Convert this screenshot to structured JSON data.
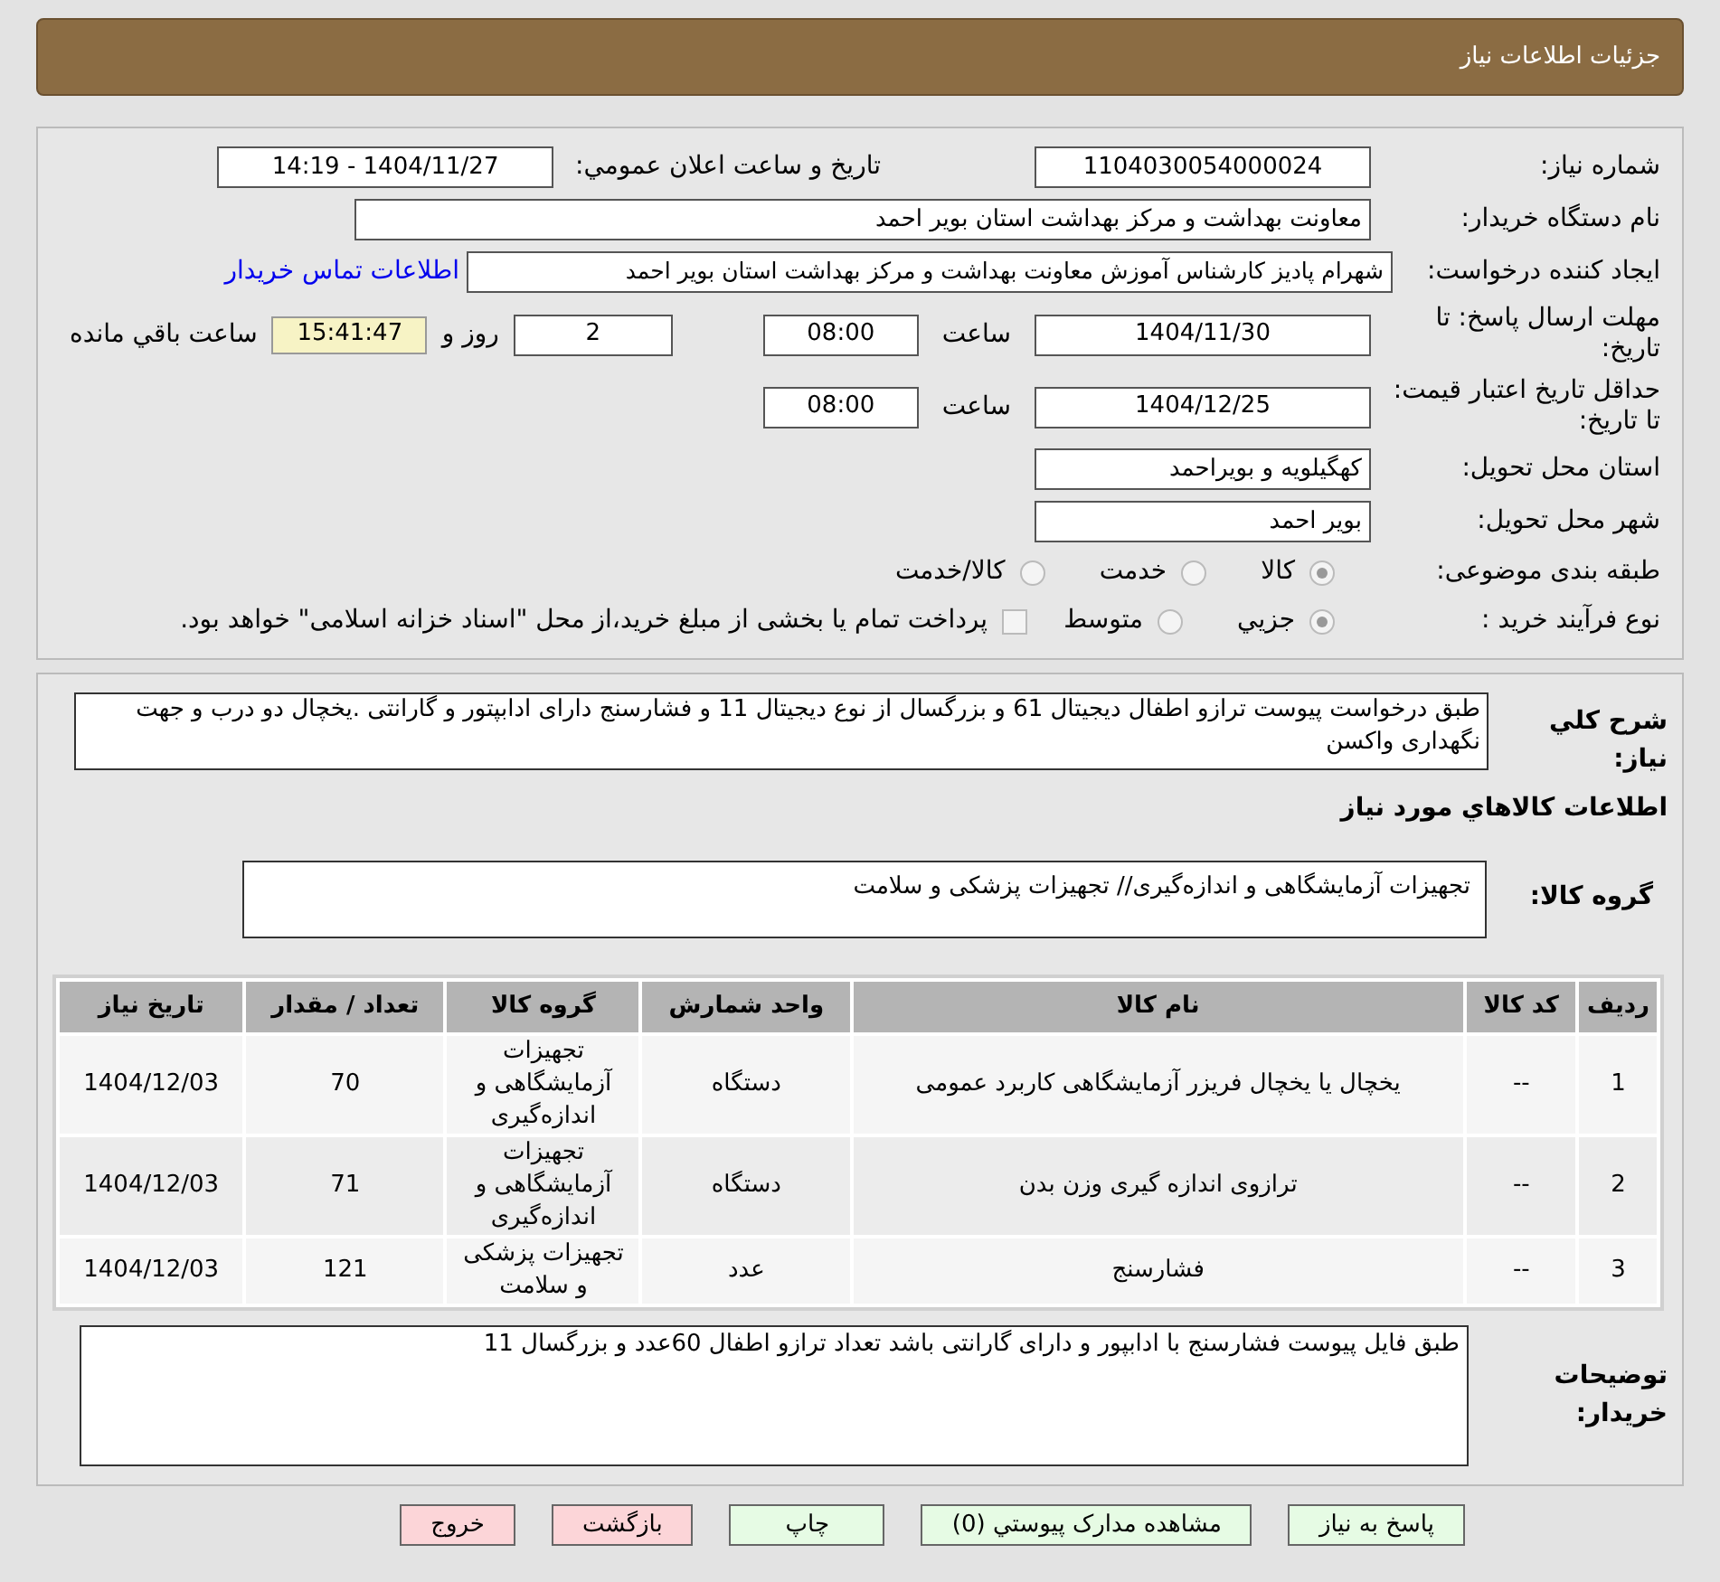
{
  "header": {
    "title": "جزئیات اطلاعات نیاز"
  },
  "info": {
    "need_number": {
      "label": "شماره نیاز:",
      "value": "1104030054000024"
    },
    "announce": {
      "label": "تاریخ و ساعت اعلان عمومي:",
      "value": "1404/11/27 - 14:19"
    },
    "buyer": {
      "label": "نام دستگاه خريدار:",
      "value": "معاونت بهداشت و مرکز بهداشت استان بویر احمد"
    },
    "creator": {
      "label": "ایجاد کننده درخواست:",
      "value": "شهرام پادیز کارشناس آموزش معاونت بهداشت و مرکز بهداشت استان بویر احمد",
      "link": "اطلاعات تماس خريدار"
    },
    "deadline": {
      "label": "مهلت ارسال پاسخ: تا تاریخ:",
      "date": "1404/11/30",
      "time_label": "ساعت",
      "time": "08:00",
      "days": "2",
      "days_label": "روز و",
      "remaining": "15:41:47",
      "remaining_label": "ساعت باقي مانده"
    },
    "validity": {
      "label": "حداقل تاریخ اعتبار قیمت: تا تاریخ:",
      "date": "1404/12/25",
      "time_label": "ساعت",
      "time": "08:00"
    },
    "province": {
      "label": "استان محل تحویل:",
      "value": "کهگیلویه و بویراحمد"
    },
    "city": {
      "label": "شهر محل تحویل:",
      "value": "بویر احمد"
    },
    "category": {
      "label": "طبقه بندی موضوعی:",
      "options": [
        {
          "label": "کالا",
          "selected": true
        },
        {
          "label": "خدمت",
          "selected": false
        },
        {
          "label": "کالا/خدمت",
          "selected": false
        }
      ]
    },
    "process": {
      "label": "نوع فرآیند خرید :",
      "options": [
        {
          "label": "جزیي",
          "selected": true
        },
        {
          "label": "متوسط",
          "selected": false
        }
      ],
      "payment": {
        "checked": false,
        "label": "پرداخت تمام یا بخشی از مبلغ خرید،از محل \"اسناد خزانه اسلامی\" خواهد بود."
      }
    }
  },
  "details": {
    "description": {
      "label": "شرح کلي نیاز:",
      "value": "طبق درخواست  پیوست  ترازو اطفال  دیجیتال 61 و بزرگسال از نوع دیجیتال 11 و  فشارسنج دارای ادابپتور و گارانتی .یخچال دو درب و جهت نگهداری واکسن"
    },
    "goods_title": "اطلاعات کالاهاي مورد نیاز",
    "group": {
      "label": "گروه کالا:",
      "value": "تجهیزات آزمایشگاهی و اندازه‌گیری// تجهیزات پزشکی و سلامت"
    },
    "table": {
      "columns": [
        "ردیف",
        "کد کالا",
        "نام کالا",
        "واحد شمارش",
        "گروه کالا",
        "تعداد / مقدار",
        "تاریخ نیاز"
      ],
      "rows": [
        [
          "1",
          "--",
          "یخچال یا یخچال فریزر آزمایشگاهی کاربرد عمومی",
          "دستگاه",
          "تجهیزات آزمایشگاهی و اندازه‌گیری",
          "70",
          "1404/12/03"
        ],
        [
          "2",
          "--",
          "ترازوی اندازه گیری وزن بدن",
          "دستگاه",
          "تجهیزات آزمایشگاهی و اندازه‌گیری",
          "71",
          "1404/12/03"
        ],
        [
          "3",
          "--",
          "فشارسنج",
          "عدد",
          "تجهیزات پزشکی و سلامت",
          "121",
          "1404/12/03"
        ]
      ]
    },
    "notes": {
      "label": "توضیحات خریدار:",
      "value": "طبق فایل پیوست فشارسنج  با ادابپور و دارای گارانتی باشد  تعداد ترازو اطفال 60عدد و بزرگسال 11"
    }
  },
  "buttons": [
    {
      "label": "پاسخ به نیاز",
      "kind": "normal"
    },
    {
      "label": "مشاهده مدارک پیوستي (0)",
      "kind": "normal"
    },
    {
      "label": "چاپ",
      "kind": "normal"
    },
    {
      "label": "بازگشت",
      "kind": "danger"
    },
    {
      "label": "خروج",
      "kind": "danger"
    }
  ]
}
